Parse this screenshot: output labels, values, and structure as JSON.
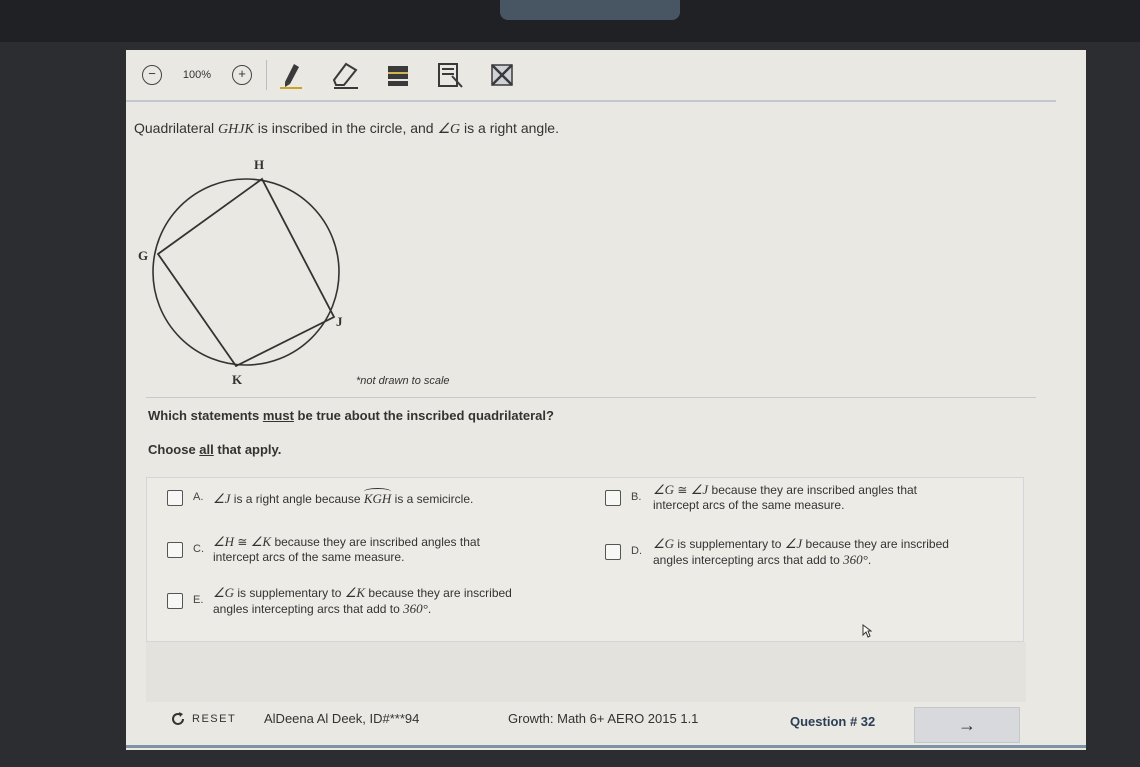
{
  "toolbar": {
    "zoom_level": "100%",
    "icons": [
      "zoom-out-icon",
      "zoom-in-icon",
      "pencil-icon",
      "eraser-icon",
      "line-reader-icon",
      "answer-masking-icon",
      "strikethrough-icon"
    ]
  },
  "question": {
    "prompt_pre": "Quadrilateral ",
    "prompt_shape": "GHJK",
    "prompt_mid": " is inscribed in the circle, and ",
    "prompt_angle": "∠G",
    "prompt_post": " is a right angle.",
    "figure_labels": {
      "H": "H",
      "G": "G",
      "J": "J",
      "K": "K"
    },
    "figure_note": "*not drawn to scale",
    "stem_pre": "Which statements ",
    "stem_emph": "must",
    "stem_post": " be true about the inscribed quadrilateral?",
    "instruction_pre": "Choose ",
    "instruction_emph": "all",
    "instruction_post": " that apply."
  },
  "answers": {
    "A": {
      "letter": "A.",
      "angle": "∠J",
      "text1": " is a right angle because ",
      "arc": "KGH",
      "text2": " is a semicircle."
    },
    "B": {
      "letter": "B.",
      "angle1": "∠G",
      "cong": " ≅ ",
      "angle2": "∠J",
      "text1": " because they are inscribed angles that",
      "text2": "intercept arcs of the same measure."
    },
    "C": {
      "letter": "C.",
      "angle1": "∠H",
      "cong": " ≅ ",
      "angle2": "∠K",
      "text1": " because they are inscribed angles that",
      "text2": "intercept arcs of the same measure."
    },
    "D": {
      "letter": "D.",
      "angle1": "∠G",
      "text1": " is supplementary to ",
      "angle2": "∠J",
      "text2": " because they are inscribed",
      "text3": "angles intercepting arcs that add to ",
      "deg": "360°",
      "end": "."
    },
    "E": {
      "letter": "E.",
      "angle1": "∠G",
      "text1": " is supplementary to ",
      "angle2": "∠K",
      "text2": " because they are inscribed",
      "text3": "angles intercepting arcs that add to ",
      "deg": "360°",
      "end": "."
    }
  },
  "footer": {
    "reset_label": "RESET",
    "student": "AlDeena Al Deek, ID#***94",
    "course": "Growth: Math 6+ AERO 2015 1.1",
    "question_number": "Question # 32",
    "next_label": "→"
  }
}
